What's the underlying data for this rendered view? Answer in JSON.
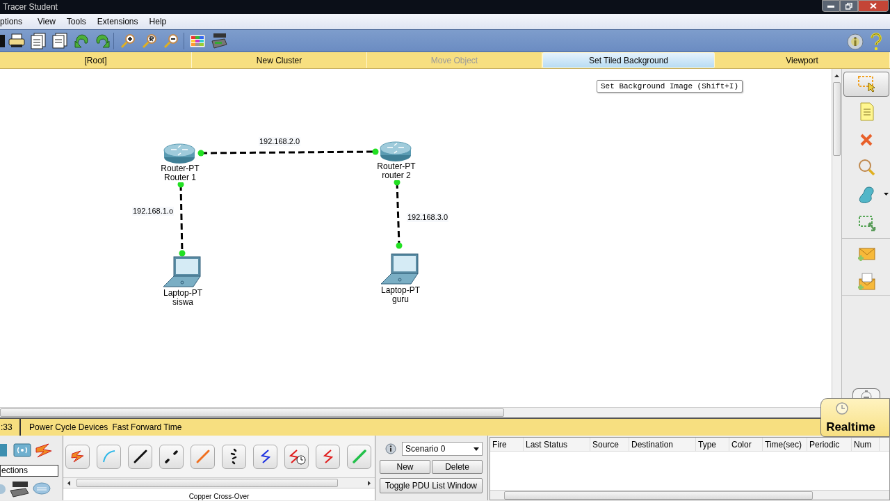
{
  "window": {
    "title": "Tracer Student"
  },
  "menu": [
    "ptions",
    "View",
    "Tools",
    "Extensions",
    "Help"
  ],
  "nav_tabs": [
    {
      "label": "[Root]",
      "selected": false,
      "disabled": false
    },
    {
      "label": "New Cluster",
      "selected": false,
      "disabled": false
    },
    {
      "label": "Move Object",
      "selected": false,
      "disabled": true
    },
    {
      "label": "Set Tiled Background",
      "selected": true,
      "disabled": false
    },
    {
      "label": "Viewport",
      "selected": false,
      "disabled": false
    }
  ],
  "tooltip": "Set Background Image (Shift+I)",
  "network": {
    "devices": [
      {
        "kind": "router",
        "model": "Router-PT",
        "name": "Router 1"
      },
      {
        "kind": "router",
        "model": "Router-PT",
        "name": "router 2"
      },
      {
        "kind": "laptop",
        "model": "Laptop-PT",
        "name": "siswa"
      },
      {
        "kind": "laptop",
        "model": "Laptop-PT",
        "name": "guru"
      }
    ],
    "links": [
      {
        "label": "192.168.2.0"
      },
      {
        "label": "192.168.1.o"
      },
      {
        "label": "192.168.3.0"
      }
    ]
  },
  "right_tools": [
    {
      "kind": "select",
      "selected": true
    },
    {
      "kind": "note",
      "selected": false
    },
    {
      "kind": "delete",
      "selected": false
    },
    {
      "kind": "inspect",
      "selected": false
    },
    {
      "kind": "shape",
      "selected": false
    },
    {
      "kind": "resize",
      "selected": false
    },
    {
      "kind": "simple_pdu",
      "selected": false
    },
    {
      "kind": "complex_pdu",
      "selected": false
    }
  ],
  "status_bar": {
    "time": ":33",
    "buttons": [
      "Power Cycle Devices",
      "Fast Forward Time"
    ],
    "mode": "Realtime"
  },
  "device_panel": {
    "category": "ections",
    "connection_name": "Copper Cross-Over"
  },
  "scenario": {
    "value": "Scenario 0",
    "buttons": [
      "New",
      "Delete"
    ],
    "toggle": "Toggle PDU List Window"
  },
  "pdu_table": {
    "columns": [
      "Fire",
      "Last Status",
      "Source",
      "Destination",
      "Type",
      "Color",
      "Time(sec)",
      "Periodic",
      "Num"
    ]
  }
}
